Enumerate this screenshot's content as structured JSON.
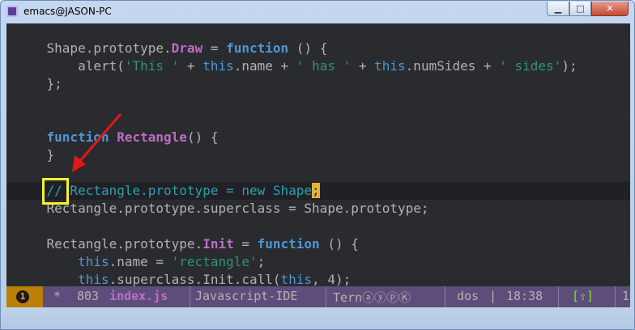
{
  "window": {
    "title": "emacs@JASON-PC",
    "minimize_glyph": "▁",
    "maximize_glyph": "□",
    "close_glyph": "✕"
  },
  "code_lines": [
    [
      {
        "t": "    Shape.prototype."
      },
      {
        "t": "Draw",
        "c": "fn"
      },
      {
        "t": " = "
      },
      {
        "t": "function",
        "c": "kw"
      },
      {
        "t": " () {"
      }
    ],
    [
      {
        "t": "        alert("
      },
      {
        "t": "'This '",
        "c": "str"
      },
      {
        "t": " + "
      },
      {
        "t": "this",
        "c": "ths"
      },
      {
        "t": ".name + "
      },
      {
        "t": "' has '",
        "c": "str"
      },
      {
        "t": " + "
      },
      {
        "t": "this",
        "c": "ths"
      },
      {
        "t": ".numSides + "
      },
      {
        "t": "' sides'",
        "c": "str"
      },
      {
        "t": ");"
      }
    ],
    [
      {
        "t": "    };"
      }
    ],
    [
      {
        "t": ""
      }
    ],
    [
      {
        "t": ""
      }
    ],
    [
      {
        "t": "    "
      },
      {
        "t": "function",
        "c": "kw"
      },
      {
        "t": " "
      },
      {
        "t": "Rectangle",
        "c": "fn"
      },
      {
        "t": "() {"
      }
    ],
    [
      {
        "t": "    }"
      }
    ],
    [
      {
        "t": ""
      }
    ],
    [
      {
        "t": "    // Rectangle.prototype = new Shape",
        "c": "cm"
      },
      {
        "t": ";",
        "c": "cursor"
      }
    ],
    [
      {
        "t": "    Rectangle.prototype.superclass = Shape.prototype;"
      }
    ],
    [
      {
        "t": ""
      }
    ],
    [
      {
        "t": "    Rectangle.prototype."
      },
      {
        "t": "Init",
        "c": "fn"
      },
      {
        "t": " = "
      },
      {
        "t": "function",
        "c": "kw"
      },
      {
        "t": " () {"
      }
    ],
    [
      {
        "t": "        "
      },
      {
        "t": "this",
        "c": "ths"
      },
      {
        "t": ".name = "
      },
      {
        "t": "'rectangle'",
        "c": "str"
      },
      {
        "t": ";"
      }
    ],
    [
      {
        "t": "        "
      },
      {
        "t": "this",
        "c": "ths"
      },
      {
        "t": ".superclass.Init.call("
      },
      {
        "t": "this",
        "c": "ths"
      },
      {
        "t": ", 4);"
      }
    ]
  ],
  "highlight_line": 8,
  "modeline": {
    "window_number": "1",
    "modified": "*",
    "size": "803",
    "filename": "index.js",
    "major_mode": "Javascript-IDE",
    "minor_modes": "TernⓐⓨⓟⓀ",
    "eol": "dos",
    "separator": "|",
    "time": "18:38",
    "vc": "[⇪]",
    "line_col": "1"
  },
  "colors": {
    "background": "#292b2e",
    "keyword": "#4f97d7",
    "function": "#bc6ec5",
    "string": "#2d9574",
    "comment": "#2aa1ae",
    "cursor": "#e3b23c",
    "modeline": "#5d4d7a",
    "annotation": "#f7f22c",
    "arrow": "#e01818"
  }
}
